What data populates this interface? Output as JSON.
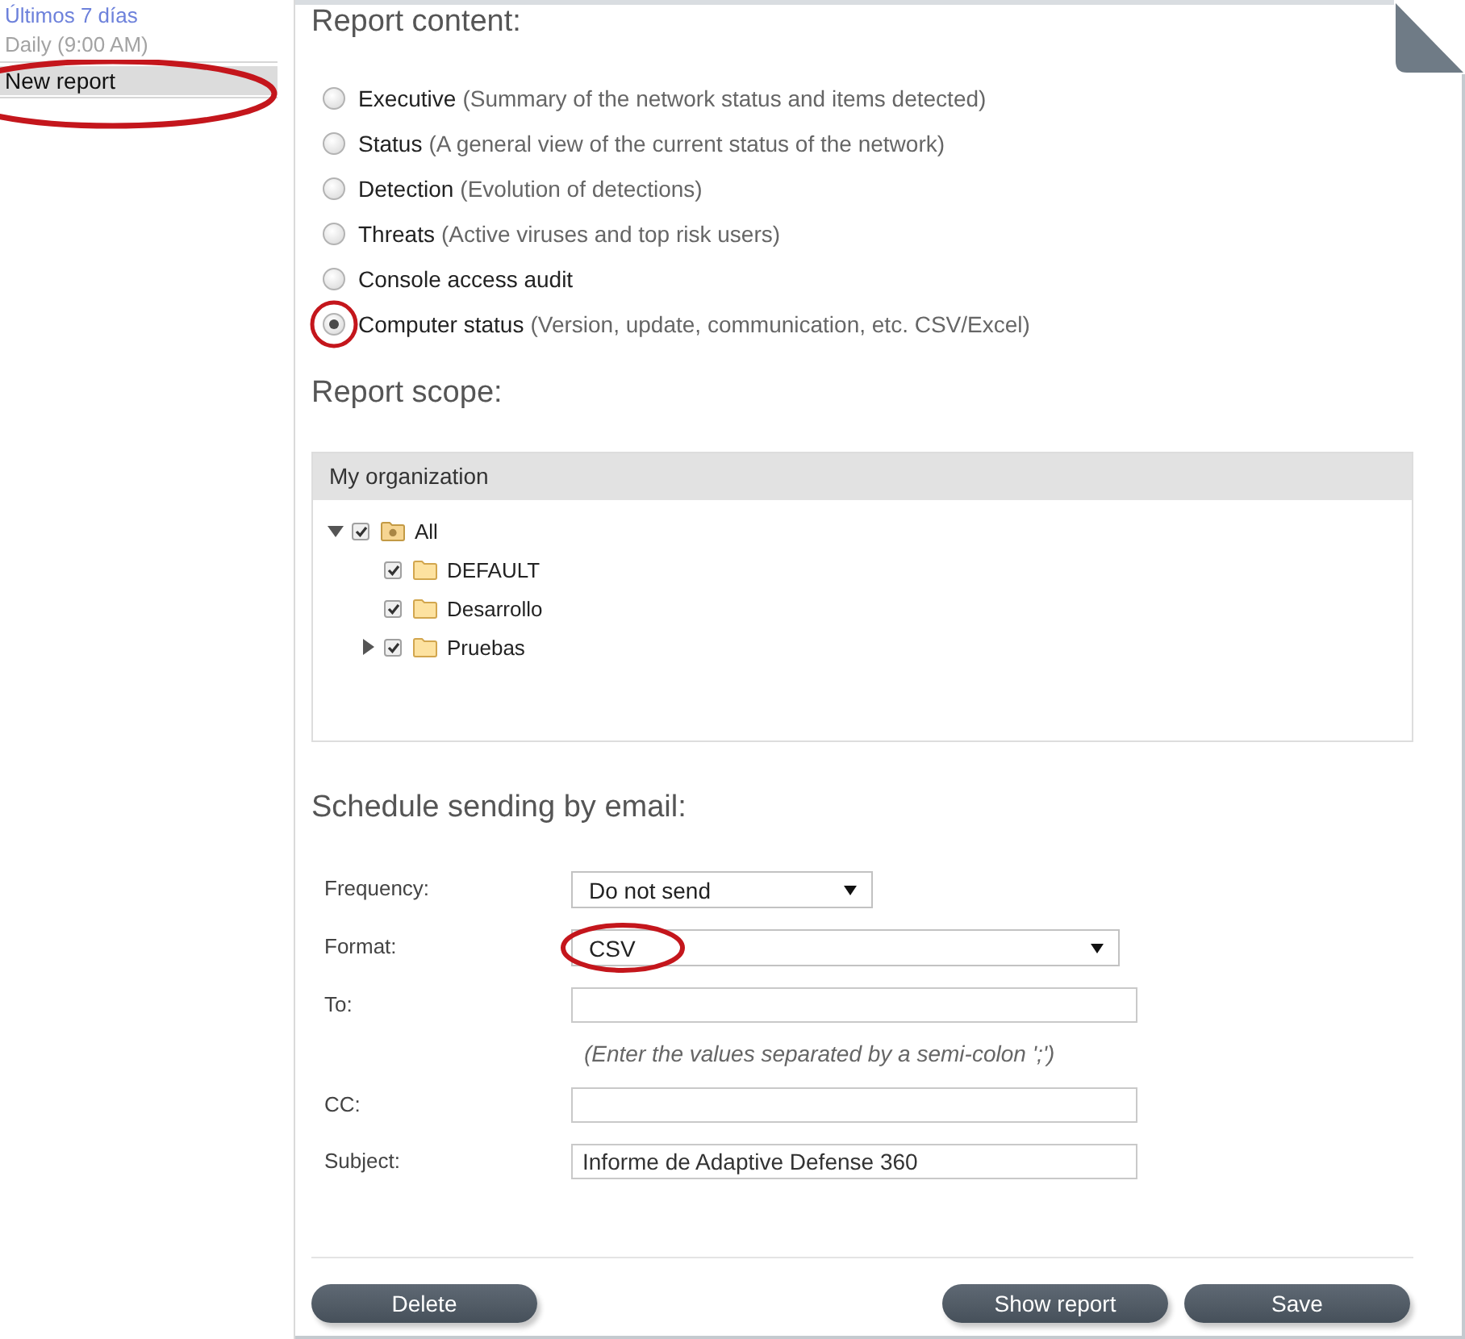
{
  "sidebar": {
    "items": [
      {
        "name": "Últimos 7 días",
        "schedule": "Daily (9:00 AM)",
        "selected": false,
        "highlighted": false
      },
      {
        "name": "New report",
        "selected": true,
        "highlighted": true
      }
    ]
  },
  "report_content": {
    "title": "Report content:",
    "options": [
      {
        "label": "Executive",
        "description": "(Summary of the network status and items detected)",
        "selected": false,
        "highlighted": false
      },
      {
        "label": "Status",
        "description": "(A general view of the current status of the network)",
        "selected": false,
        "highlighted": false
      },
      {
        "label": "Detection",
        "description": "(Evolution of detections)",
        "selected": false,
        "highlighted": false
      },
      {
        "label": "Threats",
        "description": "(Active viruses and top risk users)",
        "selected": false,
        "highlighted": false
      },
      {
        "label": "Console access audit",
        "selected": false,
        "highlighted": false
      },
      {
        "label": "Computer status",
        "description": "(Version, update, communication, etc. CSV/Excel)",
        "selected": true,
        "highlighted": true
      }
    ]
  },
  "report_scope": {
    "title": "Report scope:",
    "panel_title": "My organization",
    "tree": [
      {
        "label": "All",
        "kind": "root",
        "checked": true,
        "expanded": true,
        "children": [
          {
            "label": "DEFAULT",
            "kind": "folder",
            "checked": true
          },
          {
            "label": "Desarrollo",
            "kind": "folder",
            "checked": true
          },
          {
            "label": "Pruebas",
            "kind": "folder",
            "checked": true,
            "expanded": false
          }
        ]
      }
    ]
  },
  "schedule": {
    "title": "Schedule sending by email:",
    "fields": [
      {
        "label": "Frequency:",
        "kind": "select",
        "value": "Do not send",
        "highlighted": false
      },
      {
        "label": "Format:",
        "kind": "select",
        "value": "CSV",
        "highlighted": true
      },
      {
        "label": "To:",
        "kind": "text",
        "note": "(Enter the values separated by a semi-colon ';')"
      },
      {
        "label": "CC:",
        "kind": "text"
      },
      {
        "label": "Subject:",
        "kind": "text",
        "value": "Informe de Adaptive Defense 360"
      }
    ]
  },
  "buttons": [
    {
      "label": "Delete"
    },
    {
      "label": "Show report"
    },
    {
      "label": "Save"
    }
  ]
}
